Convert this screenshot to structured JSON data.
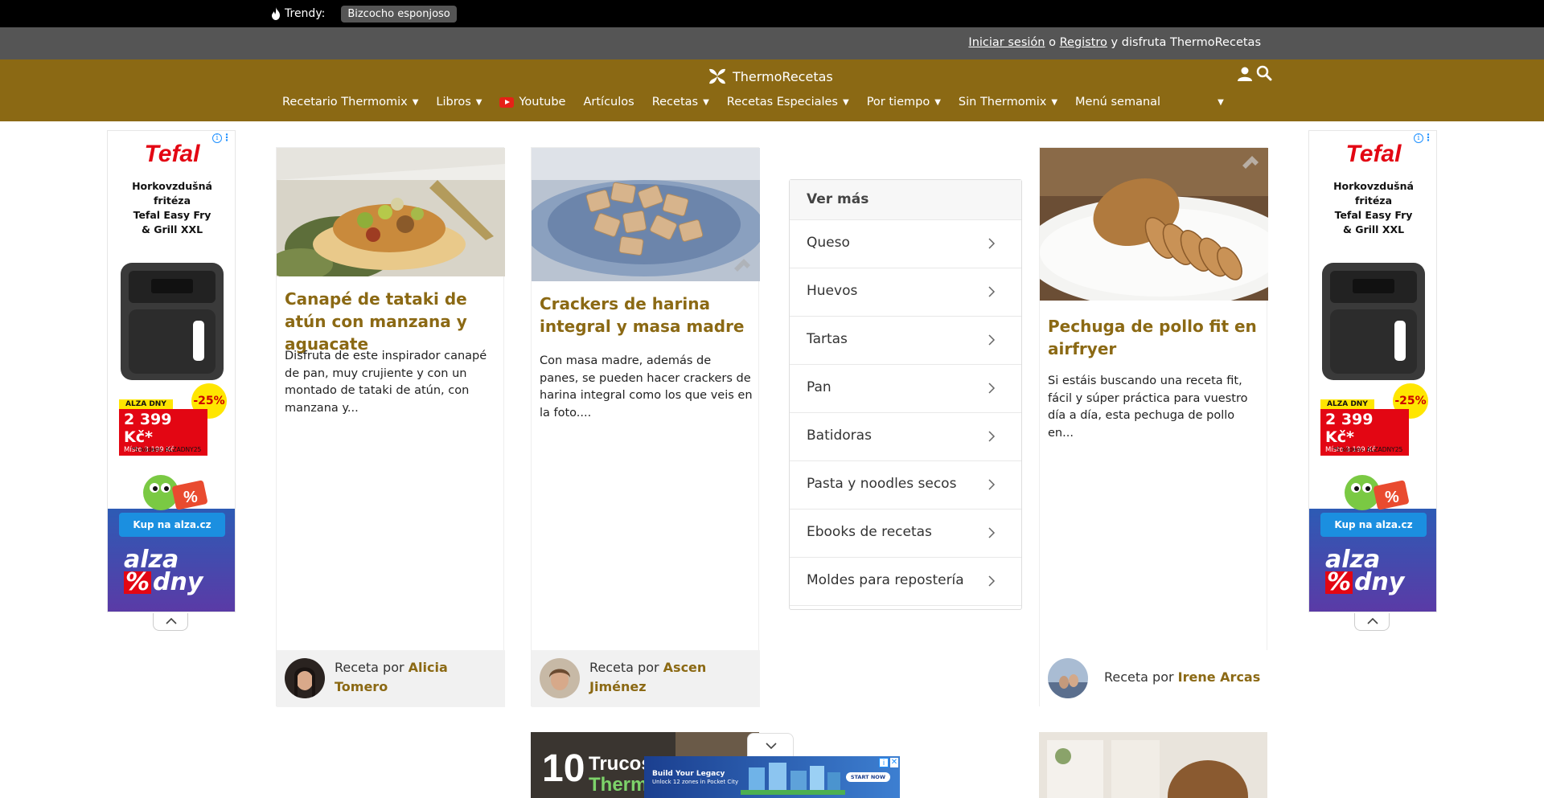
{
  "trendy": {
    "label": "Trendy:",
    "tag": "Bizcocho esponjoso"
  },
  "login": {
    "login_link": "Iniciar sesión",
    "or": " o ",
    "register_link": "Registro",
    "suffix": " y disfruta ThermoRecetas"
  },
  "brand": {
    "name": "ThermoRecetas"
  },
  "menu": [
    {
      "label": "Recetario Thermomix",
      "caret": true
    },
    {
      "label": "Libros",
      "caret": true
    },
    {
      "label": "Youtube",
      "caret": false,
      "youtube": true
    },
    {
      "label": "Artículos",
      "caret": false
    },
    {
      "label": "Recetas",
      "caret": true
    },
    {
      "label": "Recetas Especiales",
      "caret": true
    },
    {
      "label": "Por tiempo",
      "caret": true
    },
    {
      "label": "Sin Thermomix",
      "caret": true
    },
    {
      "label": "Menú semanal",
      "caret": false
    },
    {
      "label": "",
      "caret": true
    }
  ],
  "ad": {
    "brand": "Tefal",
    "line1": "Horkovzdušná",
    "line2": "fritéza",
    "line3": "Tefal Easy Fry",
    "line4": "& Grill XXL",
    "badge": "-25%",
    "alza_dny": "ALZA DNY",
    "price": "2 399 Kč*",
    "old_price": "Místo 3 199 Kč",
    "code": "*S kódem: ALZADNY25",
    "cta": "Kup na alza.cz",
    "footer_word1": "alza",
    "footer_word2": "dny",
    "footer_pct": "%"
  },
  "cards": [
    {
      "title": "Canapé de tataki de atún con manzana y aguacate",
      "desc": "Disfruta de este inspirador canapé de pan, muy crujiente y con un montado de tataki de atún, con manzana y...",
      "by": "Receta por ",
      "author": "Alicia Tomero"
    },
    {
      "title": "Crackers de harina integral y masa madre",
      "desc": "Con masa madre, además de panes, se pueden hacer crackers de harina integral como los que veis en la foto....",
      "by": "Receta por ",
      "author": "Ascen Jiménez"
    },
    {
      "title": "Pechuga de pollo fit en airfryer",
      "desc": "Si estáis buscando una receta fit, fácil y súper práctica para vuestro día a día, esta pechuga de pollo en...",
      "by": "Receta por ",
      "author": "Irene Arcas"
    }
  ],
  "vermas": {
    "heading": "Ver más",
    "items": [
      "Queso",
      "Huevos",
      "Tartas",
      "Pan",
      "Batidoras",
      "Pasta y noodles secos",
      "Ebooks de recetas",
      "Moldes para repostería"
    ]
  },
  "row2": {
    "trucos_text_1": "10",
    "trucos_text_2": "Trucos",
    "trucos_text_3": "Therm"
  },
  "bottom_ad": {
    "line1": "Build Your Legacy",
    "line2": "Unlock 12 zones in Pocket City",
    "cta": "START NOW"
  }
}
